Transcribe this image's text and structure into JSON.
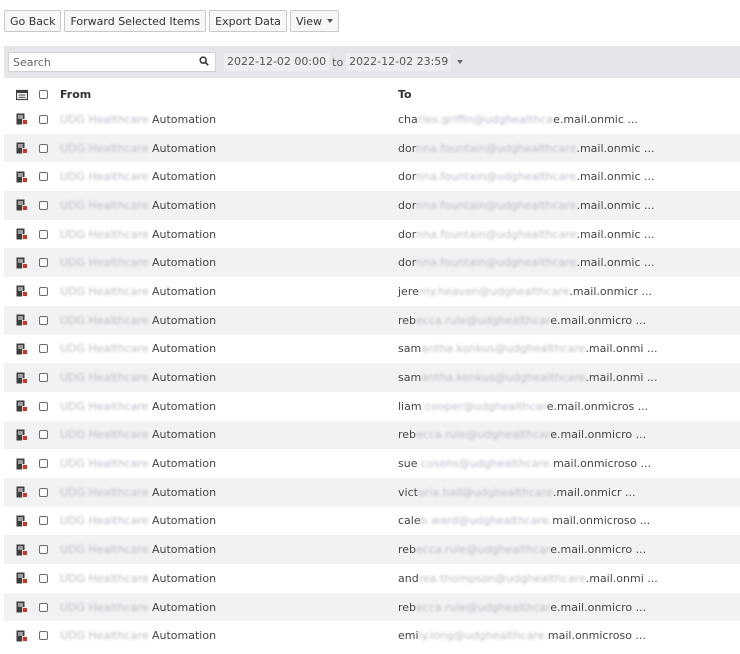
{
  "toolbar": {
    "go_back": "Go Back",
    "forward_selected": "Forward Selected Items",
    "export_data": "Export Data",
    "view": "View"
  },
  "filter": {
    "search_placeholder": "Search",
    "date_from": "2022-12-02 00:00",
    "date_to_sep": "to",
    "date_to": "2022-12-02 23:59"
  },
  "table": {
    "col_from": "From",
    "col_to": "To",
    "rows": [
      {
        "from_blur": "UDG Healthcare",
        "from": "Automation",
        "to_a": "cha",
        "to_blur": "rles.griffin@udghealthca",
        "to_b": "e.mail.onmic ..."
      },
      {
        "from_blur": "UDG Healthcare",
        "from": "Automation",
        "to_a": "dor",
        "to_blur": "nna.fountain@udghealthcare",
        "to_b": ".mail.onmic ..."
      },
      {
        "from_blur": "UDG Healthcare",
        "from": "Automation",
        "to_a": "dor",
        "to_blur": "nna.fountain@udghealthcare",
        "to_b": ".mail.onmic ..."
      },
      {
        "from_blur": "UDG Healthcare",
        "from": "Automation",
        "to_a": "dor",
        "to_blur": "nna.fountain@udghealthcare",
        "to_b": ".mail.onmic ..."
      },
      {
        "from_blur": "UDG Healthcare",
        "from": "Automation",
        "to_a": "dor",
        "to_blur": "nna.fountain@udghealthcare",
        "to_b": ".mail.onmic ..."
      },
      {
        "from_blur": "UDG Healthcare",
        "from": "Automation",
        "to_a": "dor",
        "to_blur": "nna.fountain@udghealthcare",
        "to_b": ".mail.onmic ..."
      },
      {
        "from_blur": "UDG Healthcare",
        "from": "Automation",
        "to_a": "jere",
        "to_blur": "my.heaven@udghealthcare",
        "to_b": ".mail.onmicr ..."
      },
      {
        "from_blur": "UDG Healthcare",
        "from": "Automation",
        "to_a": "reb",
        "to_blur": "ecca.rule@udghealthcar",
        "to_b": "e.mail.onmicro ..."
      },
      {
        "from_blur": "UDG Healthcare",
        "from": "Automation",
        "to_a": "sam",
        "to_blur": "antha.konkus@udghealthcare",
        "to_b": ".mail.onmi ..."
      },
      {
        "from_blur": "UDG Healthcare",
        "from": "Automation",
        "to_a": "sam",
        "to_blur": "antha.konkus@udghealthcare",
        "to_b": ".mail.onmi ..."
      },
      {
        "from_blur": "UDG Healthcare",
        "from": "Automation",
        "to_a": "liam",
        "to_blur": ".cooper@udghealthcar",
        "to_b": "e.mail.onmicros ..."
      },
      {
        "from_blur": "UDG Healthcare",
        "from": "Automation",
        "to_a": "reb",
        "to_blur": "ecca.rule@udghealthcar",
        "to_b": "e.mail.onmicro ..."
      },
      {
        "from_blur": "UDG Healthcare",
        "from": "Automation",
        "to_a": "sue",
        "to_blur": ".cosens@udghealthcare.",
        "to_b": "mail.onmicroso ..."
      },
      {
        "from_blur": "UDG Healthcare",
        "from": "Automation",
        "to_a": "vict",
        "to_blur": "oria.hall@udghealthcare",
        "to_b": ".mail.onmicr ..."
      },
      {
        "from_blur": "UDG Healthcare",
        "from": "Automation",
        "to_a": "cale",
        "to_blur": "b.ward@udghealthcare.",
        "to_b": "mail.onmicroso ..."
      },
      {
        "from_blur": "UDG Healthcare",
        "from": "Automation",
        "to_a": "reb",
        "to_blur": "ecca.rule@udghealthcar",
        "to_b": "e.mail.onmicro ..."
      },
      {
        "from_blur": "UDG Healthcare",
        "from": "Automation",
        "to_a": "and",
        "to_blur": "rea.thompson@udghealthcare",
        "to_b": ".mail.onmi ..."
      },
      {
        "from_blur": "UDG Healthcare",
        "from": "Automation",
        "to_a": "reb",
        "to_blur": "ecca.rule@udghealthcar",
        "to_b": "e.mail.onmicro ..."
      },
      {
        "from_blur": "UDG Healthcare",
        "from": "Automation",
        "to_a": "emi",
        "to_blur": "ly.long@udghealthcare.",
        "to_b": "mail.onmicroso ..."
      }
    ]
  },
  "colors": {
    "filter_bar": "#e4e6ea",
    "row_alt": "#f1f2f4",
    "icon_dark": "#3d3d3d",
    "icon_red": "#c0392b"
  }
}
